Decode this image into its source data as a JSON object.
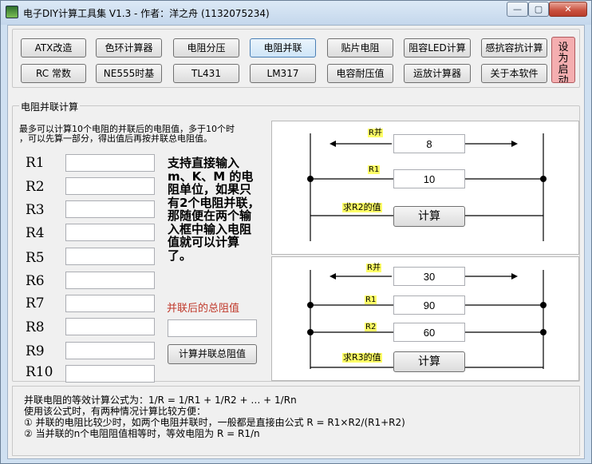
{
  "window": {
    "title": "电子DIY计算工具集 V1.3   - 作者：洋之舟 (1132075234)",
    "min_label": "—",
    "max_label": "▢",
    "close_label": "✕"
  },
  "toolbar": {
    "row1": [
      "ATX改造",
      "色环计算器",
      "电阻分压",
      "电阻并联",
      "贴片电阻",
      "阻容LED计算",
      "感抗容抗计算"
    ],
    "row2": [
      "RC 常数",
      "NE555时基",
      "TL431",
      "LM317",
      "电容耐压值",
      "运放计算器",
      "关于本软件"
    ],
    "startup_button": "设为启动首页"
  },
  "section": {
    "title": "电阻并联计算",
    "desc_line1": "最多可以计算10个电阻的并联后的电阻值，多于10个时",
    "desc_line2": "，可以先算一部分，得出值后再按并联总电阻值。"
  },
  "resistors": {
    "labels": [
      "R1",
      "R2",
      "R3",
      "R4",
      "R5",
      "R6",
      "R7",
      "R8",
      "R9",
      "R10"
    ],
    "values": [
      "",
      "",
      "",
      "",
      "",
      "",
      "",
      "",
      "",
      ""
    ]
  },
  "tip": {
    "text": "支持直接输入m、K、M 的电阻单位，如果只有2个电阻并联，那随便在两个输入框中输入电阻值就可以计算了。"
  },
  "total": {
    "label": "并联后的总阻值",
    "value": "",
    "calc_button": "计算并联总阻值"
  },
  "diagram1": {
    "label_total": "R并",
    "value_total": "8",
    "label_r1": "R1",
    "value_r1": "10",
    "label_find": "求R2的值",
    "calc_button": "计算"
  },
  "diagram2": {
    "label_total": "R并",
    "value_total": "30",
    "label_r1": "R1",
    "value_r1": "90",
    "label_r2": "R2",
    "value_r2": "60",
    "label_find": "求R3的值",
    "calc_button": "计算"
  },
  "info": {
    "line1": "并联电阻的等效计算公式为：1/R = 1/R1 + 1/R2 + … + 1/Rn",
    "line2": "使用该公式时，有两种情况计算比较方便：",
    "line3": "① 并联的电阻比较少时，如两个电阻并联时，一般都是直接由公式 R = R1×R2/(R1+R2)",
    "line4": "② 当并联的n个电阻阻值相等时，等效电阻为 R = R1/n"
  },
  "colors": {
    "title_bar": "#cfe0f1",
    "label_highlight": "#ffff66",
    "pink_button": "#f4aeb0",
    "total_label": "#c0392b"
  }
}
